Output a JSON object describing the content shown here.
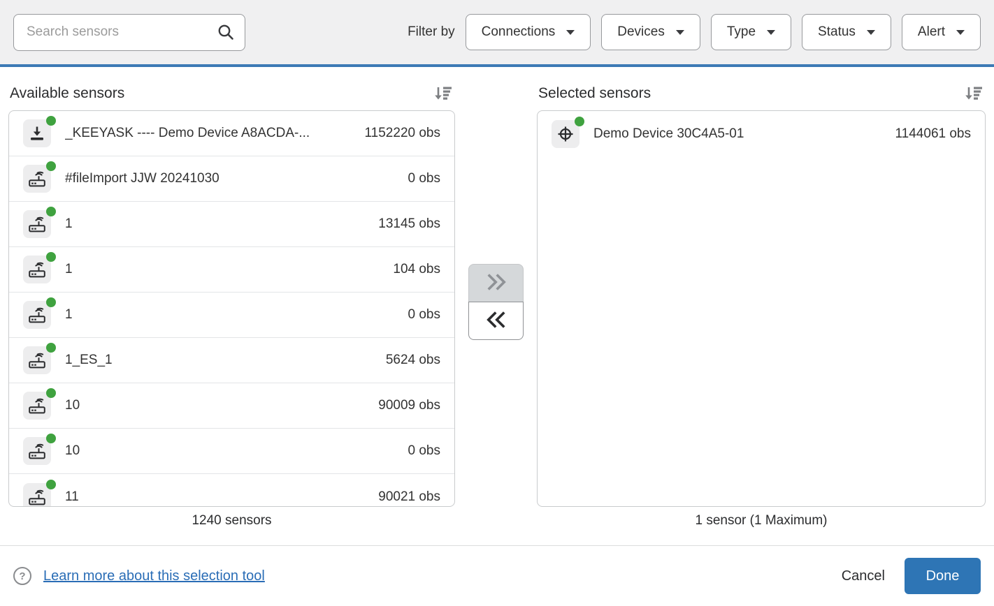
{
  "header": {
    "search_placeholder": "Search sensors",
    "filter_by_label": "Filter by",
    "filters": [
      {
        "label": "Connections"
      },
      {
        "label": "Devices"
      },
      {
        "label": "Type"
      },
      {
        "label": "Status"
      },
      {
        "label": "Alert"
      }
    ]
  },
  "available": {
    "title": "Available sensors",
    "count_label": "1240 sensors",
    "rows": [
      {
        "icon": "download-icon",
        "status": "online",
        "name": "_KEEYASK ---- Demo Device A8ACDA-...",
        "obs": "1152220 obs"
      },
      {
        "icon": "router-icon",
        "status": "online",
        "name": "#fileImport JJW 20241030",
        "obs": "0 obs"
      },
      {
        "icon": "router-icon",
        "status": "online",
        "name": "1",
        "obs": "13145 obs"
      },
      {
        "icon": "router-icon",
        "status": "online",
        "name": "1",
        "obs": "104 obs"
      },
      {
        "icon": "router-icon",
        "status": "online",
        "name": "1",
        "obs": "0 obs"
      },
      {
        "icon": "router-icon",
        "status": "online",
        "name": "1_ES_1",
        "obs": "5624 obs"
      },
      {
        "icon": "router-icon",
        "status": "online",
        "name": "10",
        "obs": "90009 obs"
      },
      {
        "icon": "router-icon",
        "status": "online",
        "name": "10",
        "obs": "0 obs"
      },
      {
        "icon": "router-icon",
        "status": "online",
        "name": "11",
        "obs": "90021 obs"
      }
    ]
  },
  "selected": {
    "title": "Selected sensors",
    "count_label": "1 sensor (1 Maximum)",
    "rows": [
      {
        "icon": "target-icon",
        "status": "online",
        "name": "Demo Device 30C4A5-01",
        "obs": "1144061 obs"
      }
    ]
  },
  "transfer": {
    "move_right_icon": "chevrons-right-icon",
    "move_left_icon": "chevrons-left-icon",
    "move_right_disabled": true
  },
  "footer": {
    "help_link": "Learn more about this selection tool",
    "cancel_label": "Cancel",
    "done_label": "Done"
  },
  "colors": {
    "accent_blue": "#2e75b5",
    "divider_blue": "#3d7ab5",
    "status_green": "#3fa23f",
    "link_blue": "#2a6db6",
    "topbar_gray": "#f0f0f1"
  }
}
